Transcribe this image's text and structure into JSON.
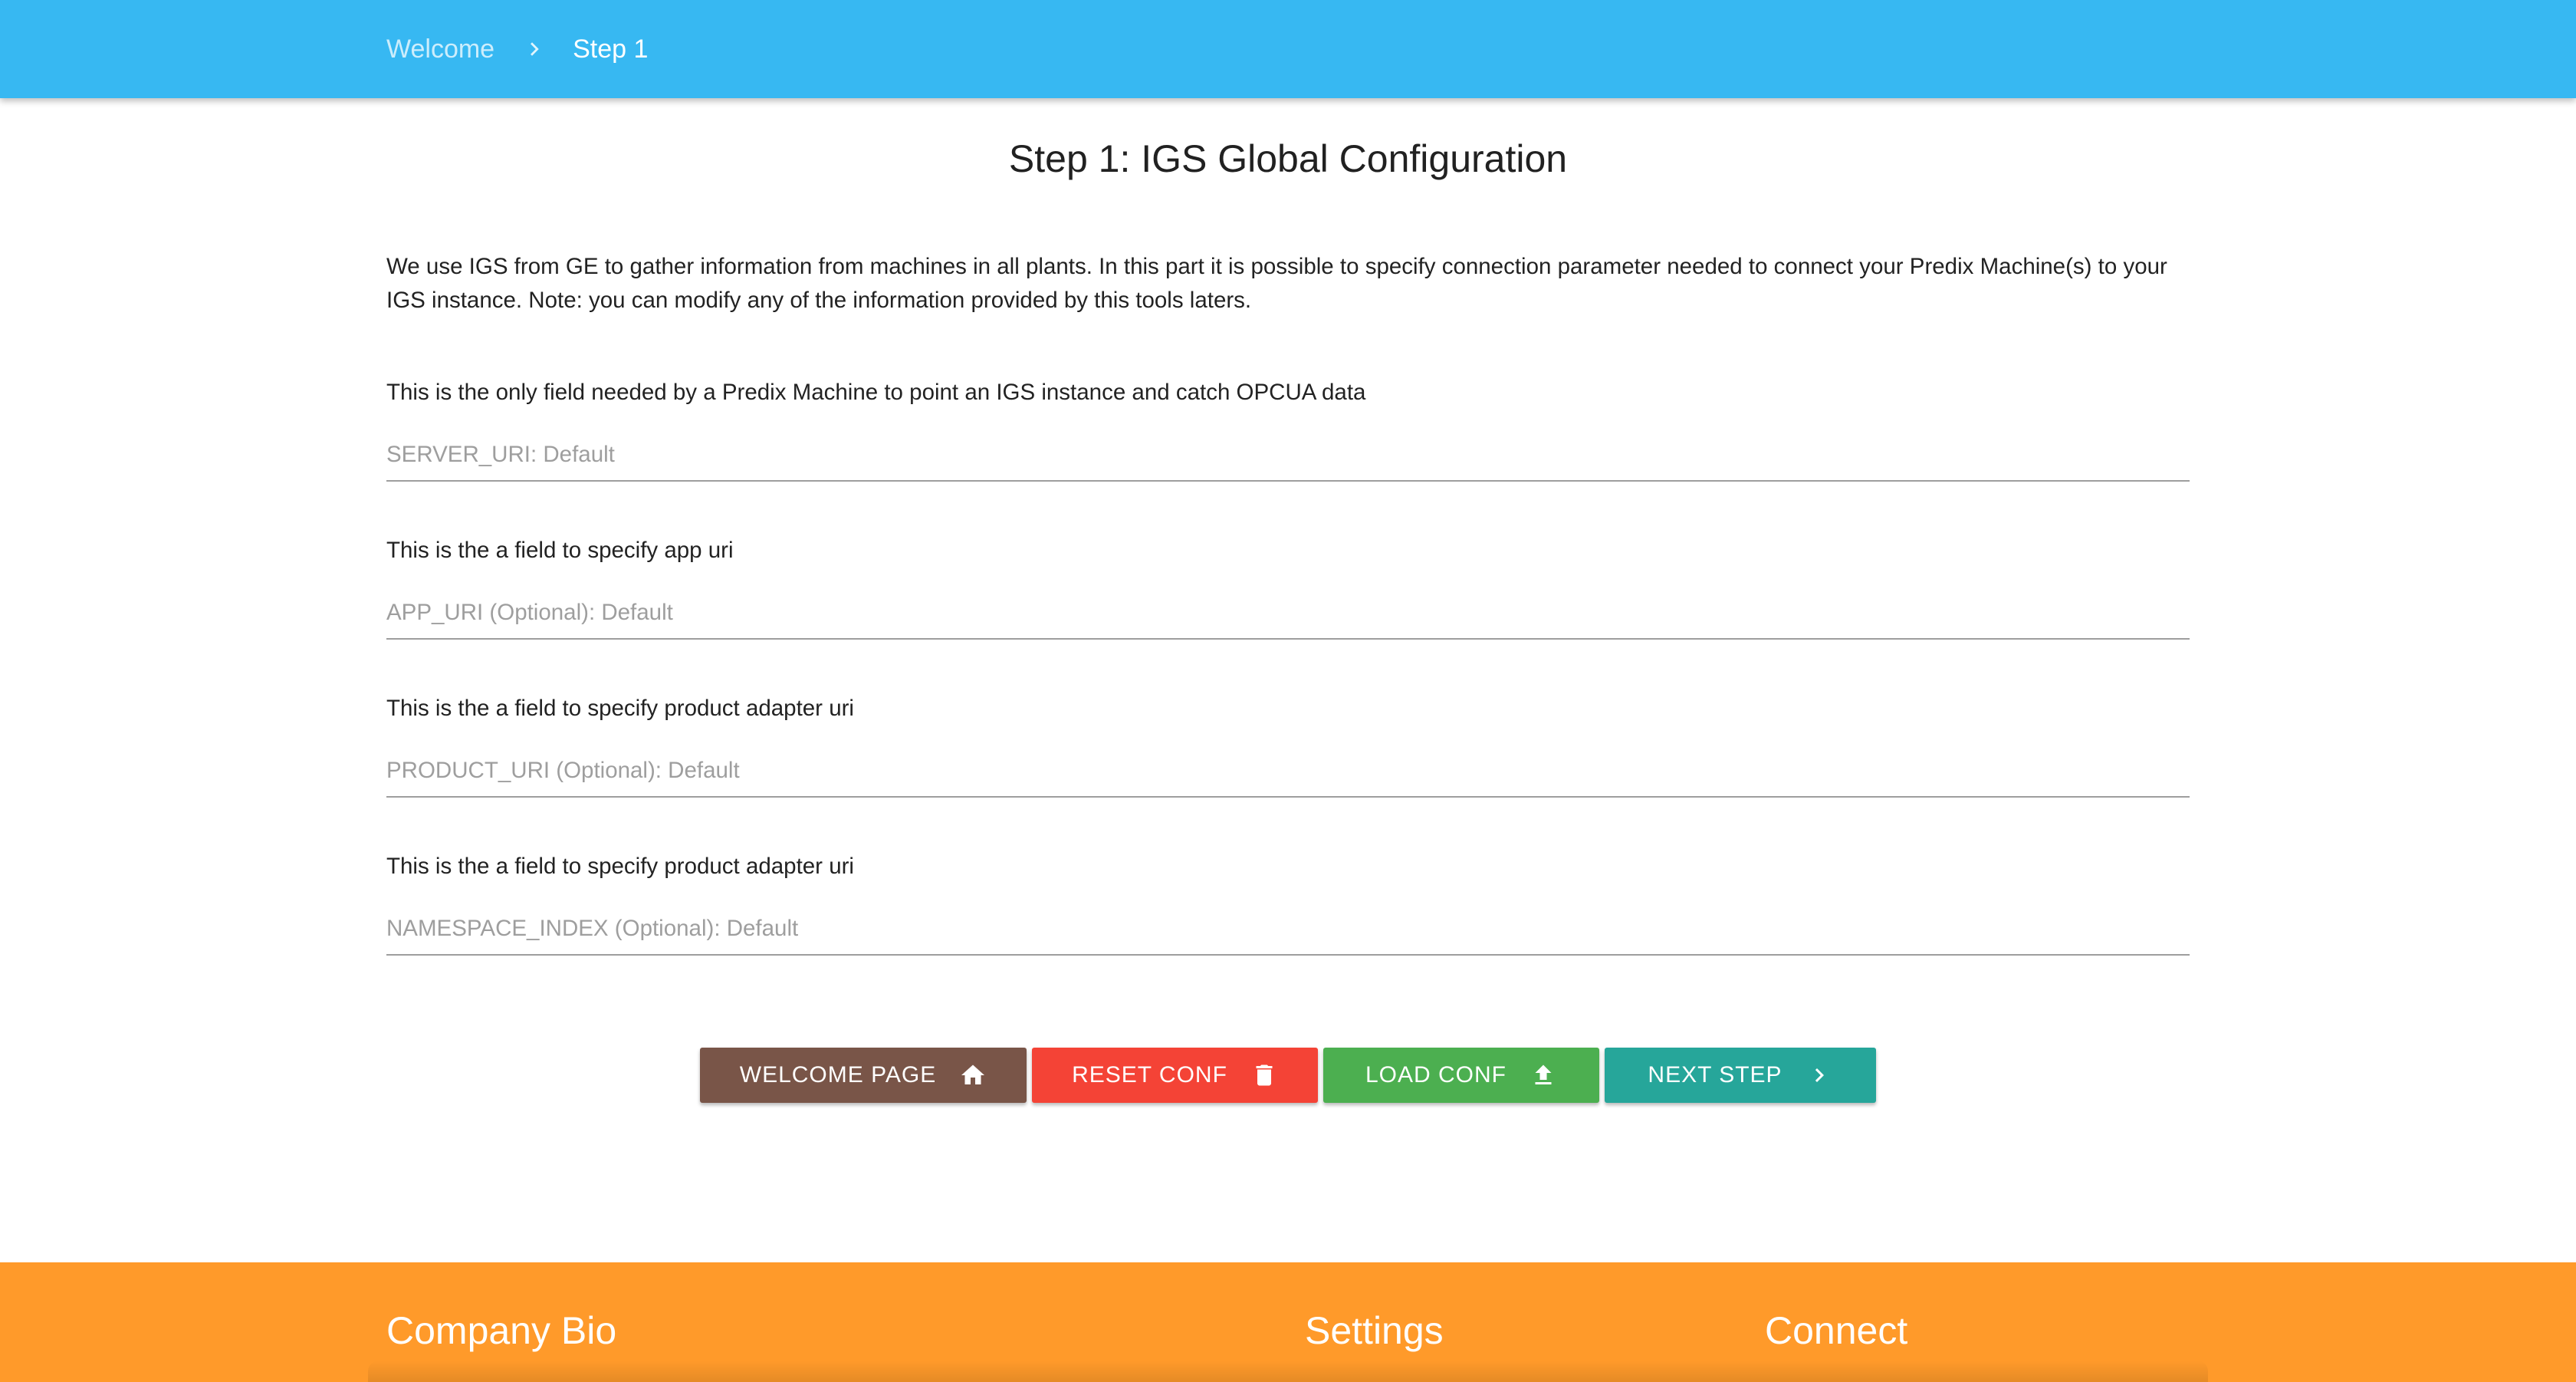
{
  "colors": {
    "header_bg": "#37b8f2",
    "footer_bg": "#ff9a2a",
    "welcome_btn": "#795548",
    "reset_btn": "#f44336",
    "load_btn": "#4caf50",
    "next_btn": "#26a69a"
  },
  "breadcrumb": {
    "home": "Welcome",
    "separator_icon": "chevron-right-icon",
    "current": "Step 1"
  },
  "main": {
    "title": "Step 1: IGS Global Configuration",
    "intro": "We use IGS from GE to gather information from machines in all plants. In this part it is possible to specify connection parameter needed to connect your Predix Machine(s) to your IGS instance. Note: you can modify any of the information provided by this tools laters.",
    "fields": [
      {
        "description": "This is the only field needed by a Predix Machine to point an IGS instance and catch OPCUA data",
        "placeholder": "SERVER_URI: Default",
        "value": ""
      },
      {
        "description": "This is the a field to specify app uri",
        "placeholder": "APP_URI (Optional): Default",
        "value": ""
      },
      {
        "description": "This is the a field to specify product adapter uri",
        "placeholder": "PRODUCT_URI (Optional): Default",
        "value": ""
      },
      {
        "description": "This is the a field to specify product adapter uri",
        "placeholder": "NAMESPACE_INDEX (Optional): Default",
        "value": ""
      }
    ]
  },
  "buttons": {
    "welcome": {
      "label": "WELCOME PAGE",
      "icon": "home-icon"
    },
    "reset": {
      "label": "RESET CONF",
      "icon": "trash-icon"
    },
    "load": {
      "label": "LOAD CONF",
      "icon": "upload-icon"
    },
    "next": {
      "label": "NEXT STEP",
      "icon": "chevron-right-icon"
    }
  },
  "footer": {
    "company_bio": "Company Bio",
    "settings": "Settings",
    "connect": "Connect"
  }
}
